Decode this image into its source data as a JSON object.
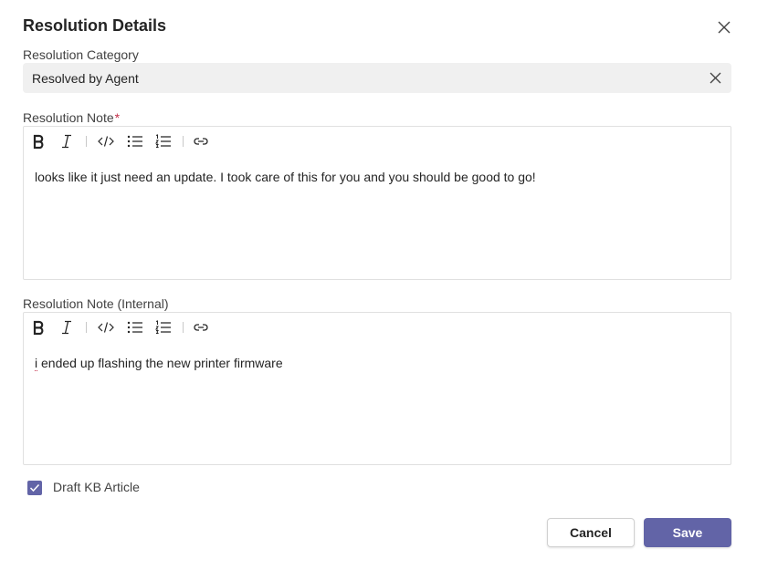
{
  "dialog": {
    "title": "Resolution Details",
    "close_icon": "close-icon"
  },
  "category": {
    "label": "Resolution Category",
    "value": "Resolved by Agent",
    "clear_icon": "clear-icon"
  },
  "resolution_note": {
    "label": "Resolution Note",
    "required_marker": "*",
    "text": "looks like it just need an update. I took care of this for you and you should be good to go!"
  },
  "internal_note": {
    "label": "Resolution Note (Internal)",
    "text_first_char": "i",
    "text_rest": " ended up flashing the new printer firmware"
  },
  "toolbar_icons": [
    "bold-icon",
    "italic-icon",
    "code-icon",
    "bullet-list-icon",
    "numbered-list-icon",
    "link-icon"
  ],
  "draft_kb": {
    "label": "Draft KB Article",
    "checked": true
  },
  "buttons": {
    "cancel": "Cancel",
    "save": "Save"
  },
  "colors": {
    "accent": "#6264a7",
    "required": "#c4314b",
    "field_bg": "#f0f0f0"
  }
}
